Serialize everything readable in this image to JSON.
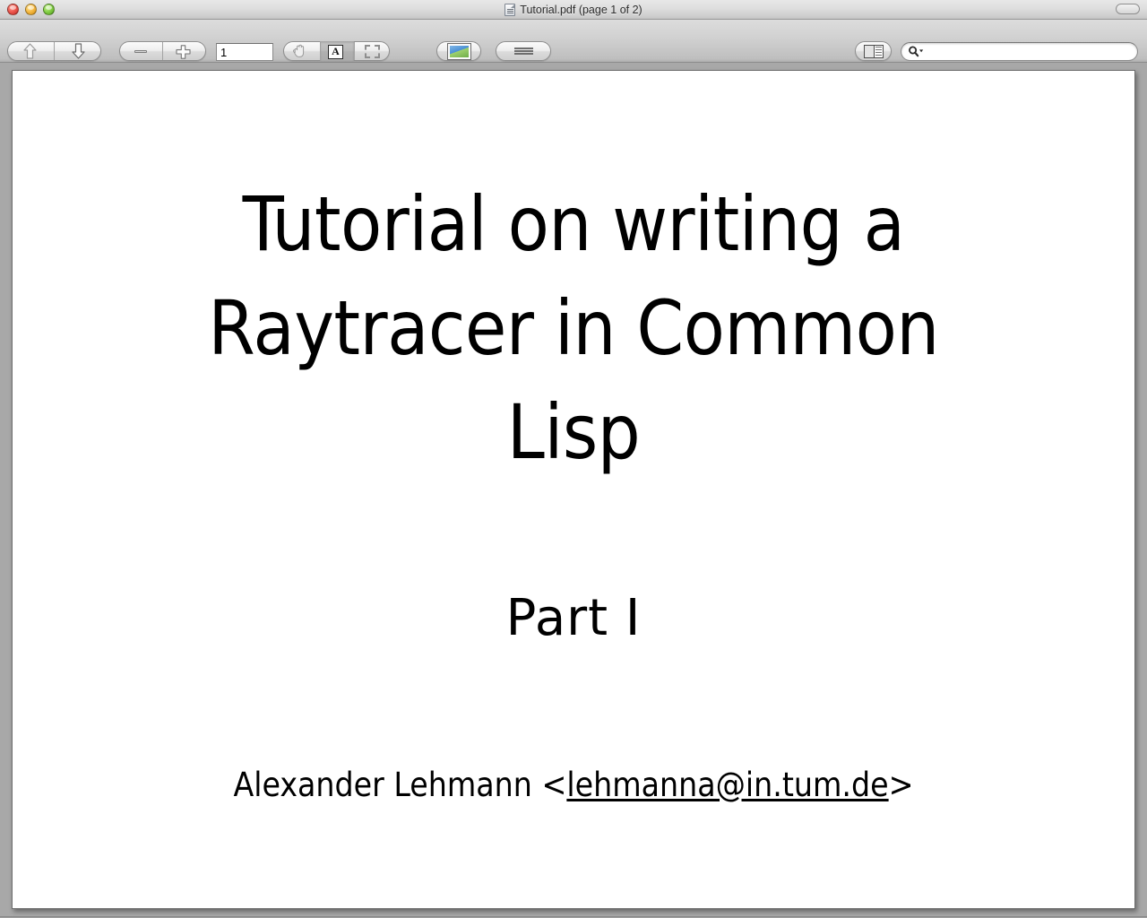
{
  "window": {
    "title": "Tutorial.pdf (page 1 of 2)",
    "doc_icon": "pdf-document-icon",
    "traffic_lights": [
      "close-button",
      "minimize-button",
      "zoom-button"
    ],
    "toolbar_toggle": "toolbar-show-hide-button"
  },
  "toolbar": {
    "previous_label": "Previous",
    "next_label": "Next",
    "zoom_label": "Zoom",
    "zoom_out_icon": "minus-icon",
    "zoom_in_icon": "plus-icon",
    "page_label": "Page",
    "page_value": "1",
    "move_label": "Move",
    "move_icon": "hand-icon",
    "text_label": "Text",
    "text_icon": "letter-a-icon",
    "select_label": "Select",
    "select_icon": "marquee-select-icon",
    "selected_mode": "Text",
    "zoom_to_fit_label": "Zoom To Fit",
    "zoom_to_fit_icon": "fit-image-icon",
    "actual_size_label": "Actual Size",
    "actual_size_icon": "actual-size-icon",
    "sidebar_label": "Sidebar",
    "sidebar_icon": "sidebar-panel-icon",
    "search_label": "Search",
    "search_value": "",
    "search_placeholder": "",
    "search_icon": "search-magnifier-icon"
  },
  "document": {
    "title": "Tutorial on writing a\nRaytracer in Common\nLisp",
    "part": "Part  I",
    "author_name": "Alexander Lehmann  <",
    "author_email": "lehmanna@in.tum.de",
    "author_close": ">"
  },
  "colors": {
    "page_background": "#ffffff",
    "window_background": "#a8a8a8",
    "toolbar_top": "#dcdcdc",
    "toolbar_bottom": "#b0b0b0",
    "text": "#000000",
    "fit_icon_accent": "#4a8fd4"
  }
}
